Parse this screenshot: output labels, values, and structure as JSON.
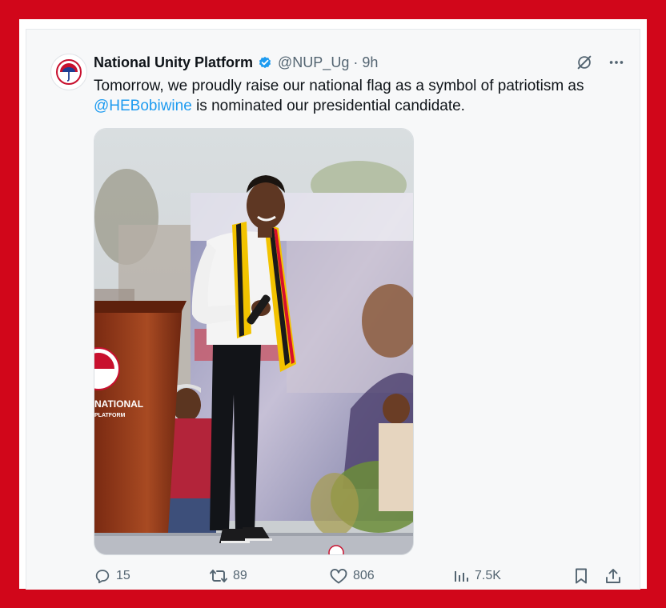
{
  "tweet": {
    "author_name": "National Unity Platform",
    "handle": "@NUP_Ug",
    "separator": "·",
    "time": "9h",
    "text_before": "Tomorrow, we proudly raise our national flag as a symbol of patriotism as ",
    "mention": "@HEBobiwine",
    "text_after": "  is nominated our presidential candidate."
  },
  "media_text": {
    "podium_label_top": "NATIONAL",
    "podium_label_bottom": "PLATFORM"
  },
  "stats": {
    "replies": "15",
    "reposts": "89",
    "likes": "806",
    "views": "7.5K"
  },
  "icons": {
    "verified": "verified-badge-icon",
    "grok": "grok-icon",
    "more": "more-icon",
    "reply": "reply-icon",
    "repost": "repost-icon",
    "like": "like-icon",
    "views": "views-icon",
    "bookmark": "bookmark-icon",
    "share": "share-icon"
  },
  "colors": {
    "frame": "#d1061a",
    "link": "#1d9bf0",
    "muted": "#536471",
    "text": "#0f1419"
  }
}
